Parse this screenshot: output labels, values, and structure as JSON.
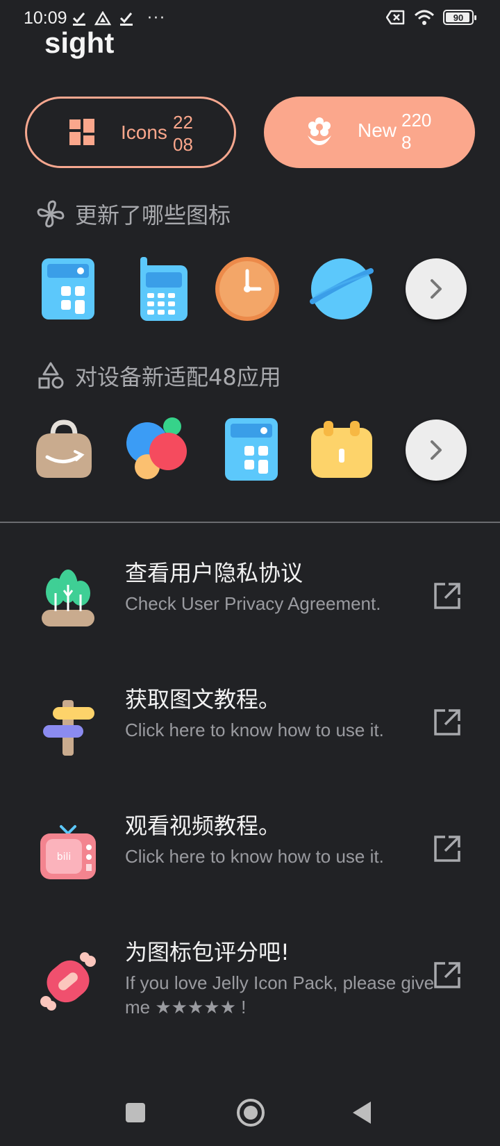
{
  "status_bar": {
    "time": "10:09",
    "more": "···",
    "battery": "90"
  },
  "header": {
    "title": "sight"
  },
  "buttons": {
    "icons": {
      "label": "Icons",
      "count_line1": "22",
      "count_line2": "08"
    },
    "new": {
      "label": "New",
      "count_line1": "220",
      "count_line2": "8"
    }
  },
  "sections": [
    {
      "title": "更新了哪些图标",
      "icon": "pinwheel-icon",
      "apps": [
        "calculator-icon",
        "phone-icon",
        "clock-icon",
        "browser-planet-icon"
      ]
    },
    {
      "title": "对设备新适配48应用",
      "icon": "shapes-icon",
      "apps": [
        "shopping-bag-icon",
        "bubbles-icon",
        "calculator-icon",
        "calendar-icon"
      ]
    }
  ],
  "list": [
    {
      "title": "查看用户隐私协议",
      "subtitle": "Check User Privacy Agreement.",
      "icon": "plant-icon"
    },
    {
      "title": "获取图文教程。",
      "subtitle": "Click here to know how to use it.",
      "icon": "signpost-icon"
    },
    {
      "title": "观看视频教程。",
      "subtitle": "Click here to know how to use it.",
      "icon": "tv-icon"
    },
    {
      "title": "为图标包评分吧!",
      "subtitle": "If you love Jelly Icon Pack, please give me ★★★★★ !",
      "icon": "candy-icon"
    }
  ],
  "colors": {
    "background": "#212225",
    "accent": "#fba78c",
    "muted_text": "#a8a9ad"
  }
}
